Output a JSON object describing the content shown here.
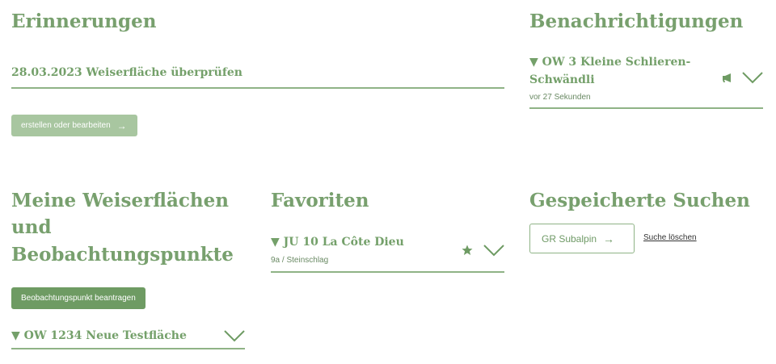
{
  "reminders": {
    "title": "Erinnerungen",
    "item": "28.03.2023 Weiserfläche überprüfen",
    "button_label": "erstellen oder bearbeiten",
    "button_icon": "arrow-right-icon"
  },
  "notifications": {
    "title": "Benachrichtigungen",
    "item_title_line1": "▼ OW 3 Kleine Schlieren-",
    "item_title_line2": "Schwändli",
    "item_time": "vor 27 Sekunden",
    "icons": [
      "megaphone-icon",
      "chevron-down-icon"
    ]
  },
  "my_areas": {
    "title_line1": "Meine Weiserflächen",
    "title_line2": "und",
    "title_line3": "Beobachtungspunkte",
    "button_label": "Beobachtungspunkt beantragen",
    "item_title": "▼ OW 1234 Neue Testfläche",
    "icons": [
      "chevron-down-icon"
    ]
  },
  "favorites": {
    "title": "Favoriten",
    "item_title": "▼ JU 10 La Côte Dieu",
    "item_sub": "9a / Steinschlag",
    "icons": [
      "star-icon",
      "chevron-down-icon"
    ]
  },
  "saved_searches": {
    "title": "Gespeicherte Suchen",
    "search_label": "GR Subalpin",
    "delete_link": "Suche löschen",
    "icons": [
      "arrow-right-icon"
    ]
  },
  "colors": {
    "accent": "#78a06e",
    "button_light": "#a8c6a0",
    "button_dark": "#6e9b63",
    "rule": "#8fb386"
  }
}
